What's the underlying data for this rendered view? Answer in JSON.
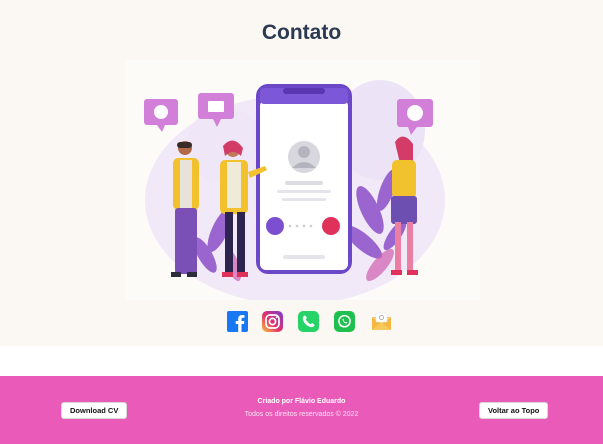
{
  "page": {
    "title": "Contato"
  },
  "social": [
    {
      "name": "facebook-icon",
      "color": "#1877f2"
    },
    {
      "name": "instagram-icon",
      "color": "#e1306c"
    },
    {
      "name": "phone-icon",
      "color": "#25d366"
    },
    {
      "name": "whatsapp-icon",
      "color": "#1fbf50"
    },
    {
      "name": "mail-icon",
      "color": "#f4b740"
    }
  ],
  "footer": {
    "download_label": "Download CV",
    "credit": "Criado por Flávio Eduardo",
    "rights": "Todos os direitos reservados © 2022",
    "top_label": "Voltar ao Topo"
  },
  "colors": {
    "footer_bg": "#ea5bb9",
    "title": "#2b3a52",
    "accent": "#7b4fd6"
  }
}
